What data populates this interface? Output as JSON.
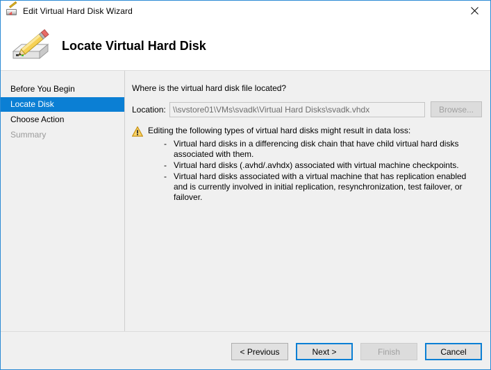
{
  "window": {
    "title": "Edit Virtual Hard Disk Wizard",
    "title_icon": "edit-virtual-hard-disk-icon",
    "close_icon": "close-icon",
    "border_color": "#2b8ad4"
  },
  "header": {
    "title": "Locate Virtual Hard Disk",
    "icon": "pencil-over-hard-disk-icon"
  },
  "sidebar": {
    "items": [
      {
        "label": "Before You Begin",
        "state": "normal"
      },
      {
        "label": "Locate Disk",
        "state": "selected"
      },
      {
        "label": "Choose Action",
        "state": "normal"
      },
      {
        "label": "Summary",
        "state": "disabled"
      }
    ],
    "selected_color": "#0b7fd4"
  },
  "content": {
    "prompt": "Where is the virtual hard disk file located?",
    "location": {
      "label": "Location:",
      "value": "\\\\svstore01\\VMs\\svadk\\Virtual Hard Disks\\svadk.vhdx",
      "placeholder": "",
      "browse_label": "Browse...",
      "browse_enabled": false
    },
    "warning": {
      "icon": "warning-triangle-icon",
      "icon_color": "#f0a30a",
      "heading": "Editing the following types of virtual hard disks might result in data loss:",
      "bullet_marker": "-",
      "items": [
        "Virtual hard disks in a differencing disk chain that have child virtual hard disks associated with them.",
        "Virtual hard disks (.avhd/.avhdx) associated with virtual machine checkpoints.",
        "Virtual hard disks associated with a virtual machine that has replication enabled and is currently involved in initial replication, resynchronization, test failover, or failover."
      ]
    }
  },
  "footer": {
    "buttons": [
      {
        "label": "< Previous",
        "style": "normal"
      },
      {
        "label": "Next >",
        "style": "default"
      },
      {
        "label": "Finish",
        "style": "disabled"
      },
      {
        "label": "Cancel",
        "style": "outlined"
      }
    ]
  }
}
